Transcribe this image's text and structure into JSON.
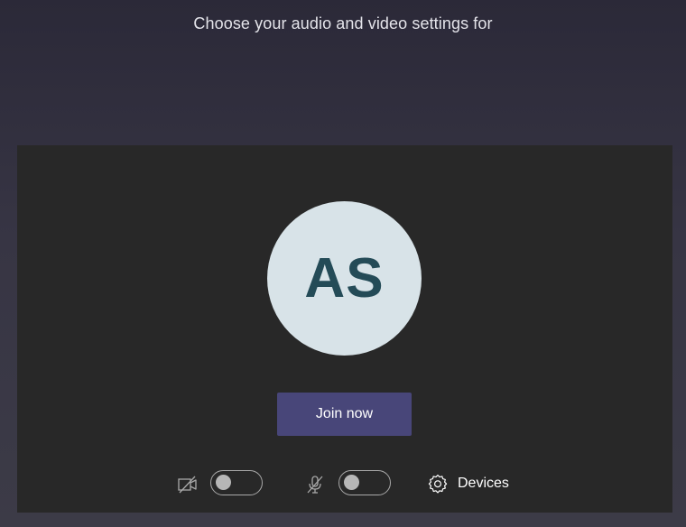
{
  "header": {
    "title": "Choose your audio and video settings for"
  },
  "preview": {
    "avatar_initials": "AS"
  },
  "actions": {
    "join_label": "Join now"
  },
  "controls": {
    "camera": {
      "icon": "camera-off-icon",
      "state": "off"
    },
    "microphone": {
      "icon": "mic-off-icon",
      "state": "off"
    },
    "devices": {
      "icon": "gear-icon",
      "label": "Devices"
    }
  },
  "colors": {
    "accent": "#484679",
    "avatar_bg": "#d8e3e8",
    "avatar_text": "#244b57",
    "preview_bg": "#282828"
  }
}
